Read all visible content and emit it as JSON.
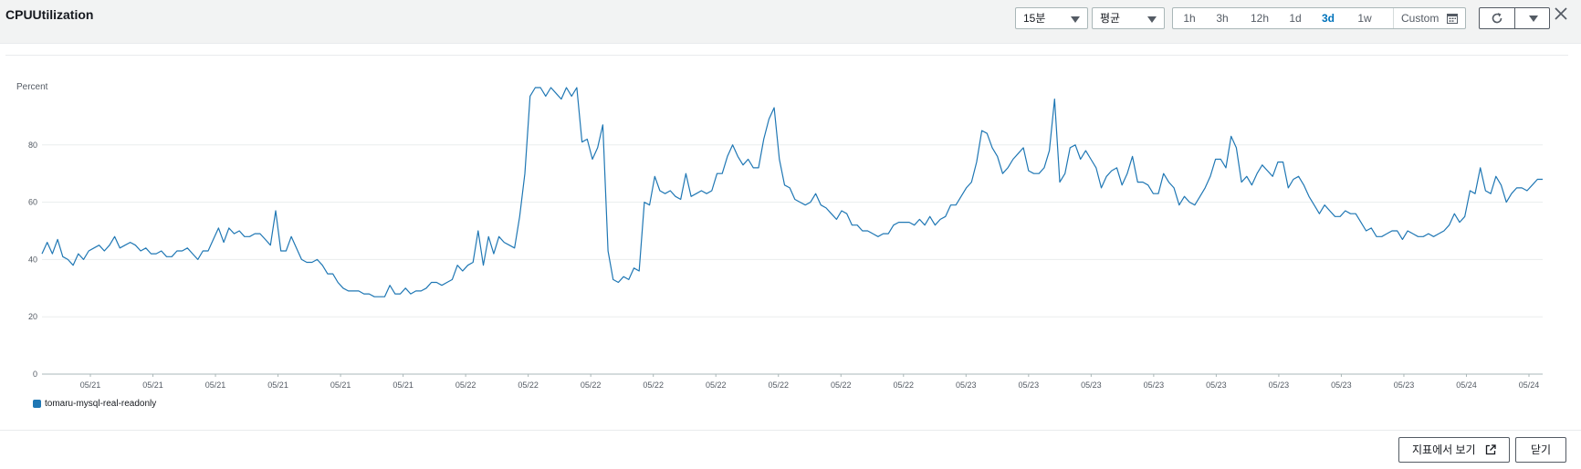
{
  "header": {
    "title": "CPUUtilization",
    "period_value": "15분",
    "statistic_value": "평균",
    "ranges": [
      {
        "label": "1h",
        "active": false
      },
      {
        "label": "3h",
        "active": false
      },
      {
        "label": "12h",
        "active": false
      },
      {
        "label": "1d",
        "active": false
      },
      {
        "label": "3d",
        "active": true
      },
      {
        "label": "1w",
        "active": false
      }
    ],
    "custom_label": "Custom",
    "icons": {
      "calendar": "calendar-icon",
      "refresh": "refresh-icon",
      "dropdown": "chevron-down-icon",
      "close": "close-icon"
    }
  },
  "chart_data": {
    "type": "line",
    "title": "CPUUtilization",
    "ylabel": "Percent",
    "ylim": [
      0,
      100
    ],
    "yticks": [
      0,
      20,
      40,
      60,
      80
    ],
    "xticks": [
      "05/21",
      "05/21",
      "05/21",
      "05/21",
      "05/21",
      "05/21",
      "05/22",
      "05/22",
      "05/22",
      "05/22",
      "05/22",
      "05/22",
      "05/22",
      "05/22",
      "05/23",
      "05/23",
      "05/23",
      "05/23",
      "05/23",
      "05/23",
      "05/23",
      "05/23",
      "05/24",
      "05/24"
    ],
    "grid": true,
    "legend": "bottom-left",
    "series": [
      {
        "name": "tomaru-mysql-real-readonly",
        "color": "#1f77b4",
        "values": [
          42,
          46,
          42,
          47,
          41,
          40,
          38,
          42,
          40,
          43,
          44,
          45,
          43,
          45,
          48,
          44,
          45,
          46,
          45,
          43,
          44,
          42,
          42,
          43,
          41,
          41,
          43,
          43,
          44,
          42,
          40,
          43,
          43,
          47,
          51,
          46,
          51,
          49,
          50,
          48,
          48,
          49,
          49,
          47,
          45,
          57,
          43,
          43,
          48,
          44,
          40,
          39,
          39,
          40,
          38,
          35,
          35,
          32,
          30,
          29,
          29,
          29,
          28,
          28,
          27,
          27,
          27,
          31,
          28,
          28,
          30,
          28,
          29,
          29,
          30,
          32,
          32,
          31,
          32,
          33,
          38,
          36,
          38,
          39,
          50,
          38,
          48,
          42,
          48,
          46,
          45,
          44,
          55,
          70,
          97,
          100,
          100,
          97,
          100,
          98,
          96,
          100,
          97,
          100,
          81,
          82,
          75,
          79,
          87,
          43,
          33,
          32,
          34,
          33,
          37,
          36,
          60,
          59,
          69,
          64,
          63,
          64,
          62,
          61,
          70,
          62,
          63,
          64,
          63,
          64,
          70,
          70,
          76,
          80,
          76,
          73,
          75,
          72,
          72,
          82,
          89,
          93,
          75,
          66,
          65,
          61,
          60,
          59,
          60,
          63,
          59,
          58,
          56,
          54,
          57,
          56,
          52,
          52,
          50,
          50,
          49,
          48,
          49,
          49,
          52,
          53,
          53,
          53,
          52,
          54,
          52,
          55,
          52,
          54,
          55,
          59,
          59,
          62,
          65,
          67,
          74,
          85,
          84,
          79,
          76,
          70,
          72,
          75,
          77,
          79,
          71,
          70,
          70,
          72,
          78,
          96,
          67,
          70,
          79,
          80,
          75,
          78,
          75,
          72,
          65,
          69,
          71,
          72,
          66,
          70,
          76,
          67,
          67,
          66,
          63,
          63,
          70,
          67,
          65,
          59,
          62,
          60,
          59,
          62,
          65,
          69,
          75,
          75,
          72,
          83,
          79,
          67,
          69,
          66,
          70,
          73,
          71,
          69,
          74,
          74,
          65,
          68,
          69,
          66,
          62,
          59,
          56,
          59,
          57,
          55,
          55,
          57,
          56,
          56,
          53,
          50,
          51,
          48,
          48,
          49,
          50,
          50,
          47,
          50,
          49,
          48,
          48,
          49,
          48,
          49,
          50,
          52,
          56,
          53,
          55,
          64,
          63,
          72,
          64,
          63,
          69,
          66,
          60,
          63,
          65,
          65,
          64,
          66,
          68,
          68
        ]
      }
    ]
  },
  "footer": {
    "view_in_metrics_label": "지표에서 보기",
    "close_label": "닫기"
  }
}
